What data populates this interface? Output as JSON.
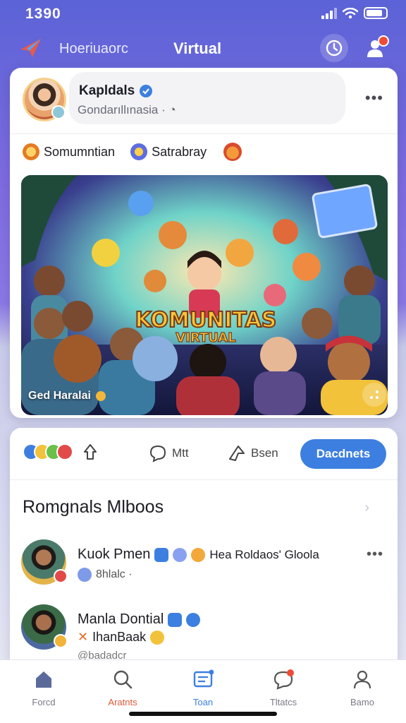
{
  "status_bar": {
    "time": "1390"
  },
  "header": {
    "subtitle": "Hoeriuaorc",
    "title": "Virtual"
  },
  "post": {
    "author_name": "Kapldals",
    "author_sub": "Gondarıllınasia · ◔",
    "tags": [
      "Somumntian",
      "Satrabray"
    ],
    "image_title_line1": "KOMUNITAS",
    "image_title_line2": "VIRTUAL",
    "image_caption": "Ged Haralai"
  },
  "actions": {
    "comment_label": "Mtt",
    "share_label": "Bsen",
    "follow_label": "Dacdnets"
  },
  "section": {
    "title": "Romgnals Mlboos"
  },
  "friends": [
    {
      "name": "Kuok Pmen",
      "extra": "Hea Roldaos' Gloola",
      "sub": "8hlalc ·"
    },
    {
      "name": "Manla Dontial",
      "sub": "IhanBaak",
      "sub2": "@badadcr"
    }
  ],
  "nav": [
    "Forcd",
    "Aratnts",
    "Toan",
    "Tltatcs",
    "Bamo"
  ],
  "colors": {
    "accent": "#3d7fe0",
    "brand_gradient_top": "#5b63d6",
    "badge": "#ef4b36"
  }
}
